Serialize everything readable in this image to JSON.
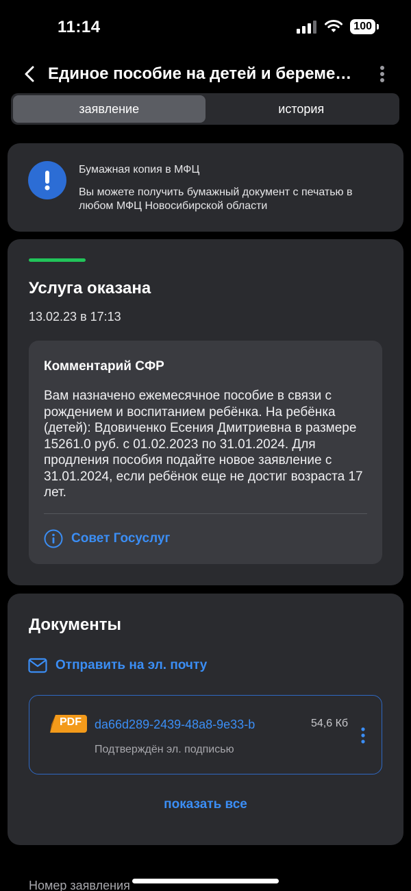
{
  "status_bar": {
    "time": "11:14",
    "battery": "100"
  },
  "nav": {
    "title": "Единое пособие на детей и беременных"
  },
  "tabs": [
    {
      "label": "заявление",
      "active": true
    },
    {
      "label": "история",
      "active": false
    }
  ],
  "notice": {
    "title": "Бумажная копия в МФЦ",
    "text": "Вы можете получить бумажный документ с печатью в любом МФЦ Новосибирской области"
  },
  "status": {
    "title": "Услуга оказана",
    "date": "13.02.23 в 17:13",
    "color": "#21c45a",
    "comment_title": "Комментарий СФР",
    "comment_text": "Вам назначено ежемесячное пособие в связи с рождением и воспитанием ребёнка. На ребёнка (детей): Вдовиченко Есения Дмитриевна в размере 15261.0 руб. с 01.02.2023 по 31.01.2024. Для продления пособия подайте новое заявление с 31.01.2024, если ребёнок еще не достиг возраста 17 лет.",
    "tip_label": "Совет Госуслуг"
  },
  "documents": {
    "title": "Документы",
    "email_label": "Отправить на эл. почту",
    "files": [
      {
        "badge": "PDF",
        "name": "da66d289-2439-48a8-9e33-b",
        "size": "54,6 Кб",
        "subtitle": "Подтверждён эл. подписью"
      }
    ],
    "show_all": "показать все"
  },
  "footer": {
    "app_number_label": "Номер заявления"
  },
  "colors": {
    "accent": "#3b8ef5",
    "card": "#2a2b2f",
    "pdf": "#f39a1a",
    "info": "#2c6dd5"
  }
}
